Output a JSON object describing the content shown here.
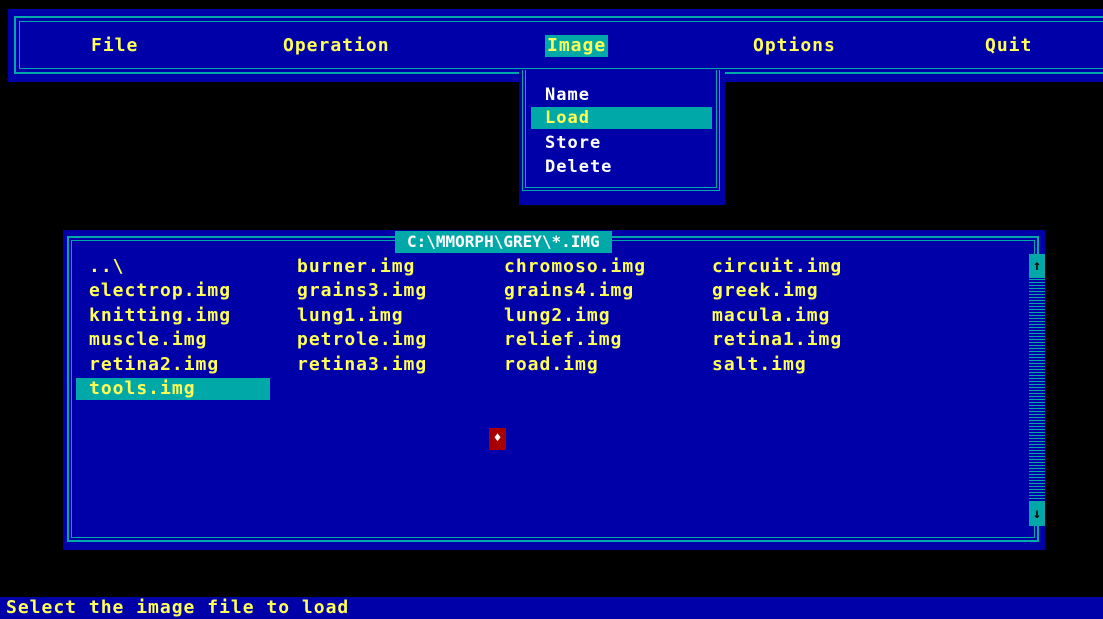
{
  "menu": {
    "file": "File",
    "operation": "Operation",
    "image": "Image",
    "options": "Options",
    "quit": "Quit"
  },
  "image_menu": {
    "items": [
      "Name",
      "Load",
      "Store",
      "Delete"
    ],
    "selected": "Load"
  },
  "file_dialog": {
    "path": "C:\\MMORPH\\GREY\\*.IMG",
    "files": [
      "..\\",
      "burner.img",
      "chromoso.img",
      "circuit.img",
      "electrop.img",
      "grains3.img",
      "grains4.img",
      "greek.img",
      "knitting.img",
      "lung1.img",
      "lung2.img",
      "macula.img",
      "muscle.img",
      "petrole.img",
      "relief.img",
      "retina1.img",
      "retina2.img",
      "retina3.img",
      "road.img",
      "salt.img",
      "tools.img"
    ],
    "selected": "tools.img"
  },
  "scrollbar": {
    "up_icon": "arrow-up-icon",
    "down_icon": "arrow-down-icon"
  },
  "mouse_cursor": {
    "icon": "diamond-icon",
    "glyph": "♦"
  },
  "status": {
    "message": "Select the image file to load"
  },
  "colors": {
    "background": "#000000",
    "panel": "#0000a8",
    "accent": "#00a8a8",
    "text": "#ffff55",
    "cursor": "#a80000"
  }
}
